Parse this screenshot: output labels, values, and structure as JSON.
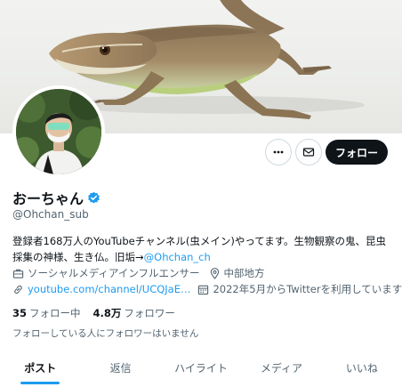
{
  "profile": {
    "display_name": "おーちゃん",
    "handle": "@Ohchan_sub",
    "bio_text": "登録者168万人のYouTubeチャンネル(虫メイン)やってます。生物観察の鬼、昆虫採集の神様、生き仏。旧垢→",
    "bio_link": "@Ohchan_ch",
    "category": "ソーシャルメディアインフルエンサー",
    "location": "中部地方",
    "website": "youtube.com/channel/UCQJaE…",
    "joined": "2022年5月からTwitterを利用しています",
    "following_count": "35",
    "following_label": "フォロー中",
    "followers_count": "4.8万",
    "followers_label": "フォロワー",
    "followed_note": "フォローしている人にフォロワーはいません"
  },
  "actions": {
    "follow_label": "フォロー"
  },
  "tabs": [
    {
      "label": "ポスト"
    },
    {
      "label": "返信"
    },
    {
      "label": "ハイライト"
    },
    {
      "label": "メディア"
    },
    {
      "label": "いいね"
    }
  ],
  "colors": {
    "accent": "#1d9bf0",
    "text": "#0f1419",
    "muted": "#536471"
  }
}
